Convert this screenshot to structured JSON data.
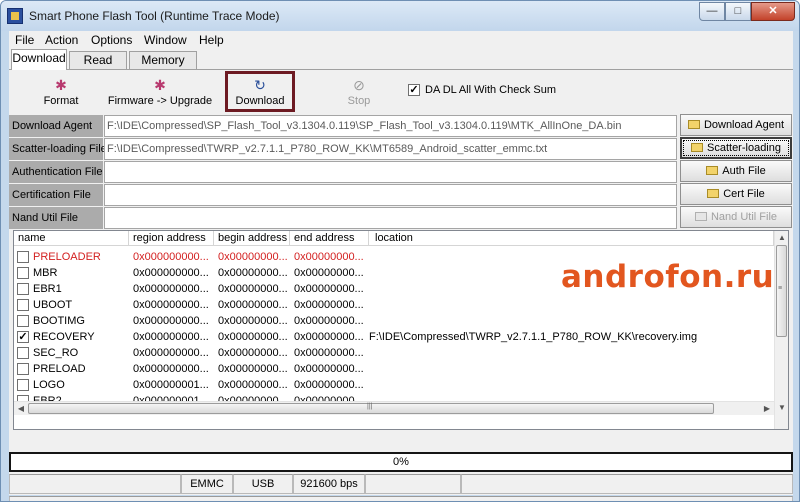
{
  "window": {
    "title": "Smart Phone Flash Tool (Runtime Trace Mode)",
    "controls": {
      "minimize": "—",
      "maximize": "□",
      "close": "✕"
    }
  },
  "menu": {
    "file": "File",
    "action": "Action",
    "options": "Options",
    "window": "Window",
    "help": "Help"
  },
  "tabs": {
    "download": "Download",
    "readback": "Read back",
    "memtest": "Memory Test"
  },
  "toolbar": {
    "format": "Format",
    "firmware_upgrade": "Firmware -> Upgrade",
    "download": "Download",
    "stop": "Stop",
    "da_checksum_label": "DA DL All With Check Sum",
    "da_checksum_checked": true
  },
  "fields": {
    "download_agent": {
      "label": "Download Agent",
      "value": "F:\\IDE\\Compressed\\SP_Flash_Tool_v3.1304.0.119\\SP_Flash_Tool_v3.1304.0.119\\MTK_AllInOne_DA.bin"
    },
    "scatter": {
      "label": "Scatter-loading File",
      "value": "F:\\IDE\\Compressed\\TWRP_v2.7.1.1_P780_ROW_KK\\MT6589_Android_scatter_emmc.txt"
    },
    "authentication": {
      "label": "Authentication File",
      "value": ""
    },
    "certification": {
      "label": "Certification File",
      "value": ""
    },
    "nand_util": {
      "label": "Nand Util File",
      "value": ""
    }
  },
  "side_buttons": {
    "download_agent": "Download Agent",
    "scatter_loading": "Scatter-loading",
    "auth_file": "Auth File",
    "cert_file": "Cert File",
    "nand_file": "Nand Util File"
  },
  "table": {
    "headers": [
      "name",
      "region address",
      "begin address",
      "end address",
      "location"
    ],
    "rows": [
      {
        "name": "PRELOADER",
        "region": "0x000000000...",
        "begin": "0x00000000...",
        "end": "0x00000000...",
        "location": "",
        "checked": false,
        "highlight": true
      },
      {
        "name": "MBR",
        "region": "0x000000000...",
        "begin": "0x00000000...",
        "end": "0x00000000...",
        "location": "",
        "checked": false,
        "highlight": false
      },
      {
        "name": "EBR1",
        "region": "0x000000000...",
        "begin": "0x00000000...",
        "end": "0x00000000...",
        "location": "",
        "checked": false,
        "highlight": false
      },
      {
        "name": "UBOOT",
        "region": "0x000000000...",
        "begin": "0x00000000...",
        "end": "0x00000000...",
        "location": "",
        "checked": false,
        "highlight": false
      },
      {
        "name": "BOOTIMG",
        "region": "0x000000000...",
        "begin": "0x00000000...",
        "end": "0x00000000...",
        "location": "",
        "checked": false,
        "highlight": false
      },
      {
        "name": "RECOVERY",
        "region": "0x000000000...",
        "begin": "0x00000000...",
        "end": "0x00000000...",
        "location": "F:\\IDE\\Compressed\\TWRP_v2.7.1.1_P780_ROW_KK\\recovery.img",
        "checked": true,
        "highlight": false
      },
      {
        "name": "SEC_RO",
        "region": "0x000000000...",
        "begin": "0x00000000...",
        "end": "0x00000000...",
        "location": "",
        "checked": false,
        "highlight": false
      },
      {
        "name": "PRELOAD",
        "region": "0x000000000...",
        "begin": "0x00000000...",
        "end": "0x00000000...",
        "location": "",
        "checked": false,
        "highlight": false
      },
      {
        "name": "LOGO",
        "region": "0x000000001...",
        "begin": "0x00000000...",
        "end": "0x00000000...",
        "location": "",
        "checked": false,
        "highlight": false
      },
      {
        "name": "EBR2",
        "region": "0x000000001...",
        "begin": "0x00000000...",
        "end": "0x00000000...",
        "location": "",
        "checked": false,
        "highlight": false
      }
    ]
  },
  "progress": {
    "label": "0%",
    "value": 0
  },
  "status": {
    "storage": "EMMC",
    "port": "USB",
    "baud": "921600 bps"
  },
  "watermark": "androfon.ru",
  "colors": {
    "highlight_red": "#d32020",
    "download_frame": "#6d1a22",
    "watermark": "#e2561f"
  },
  "icons": {
    "format": "format-icon",
    "firmware": "firmware-upgrade-icon",
    "download": "download-icon",
    "stop": "stop-icon",
    "folder": "folder-icon"
  }
}
